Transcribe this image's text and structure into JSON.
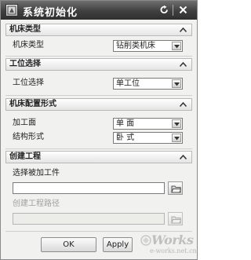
{
  "window": {
    "title": "系统初始化",
    "reset_icon": "reset-icon",
    "close_icon": "close-icon"
  },
  "sections": {
    "machine_type": {
      "title": "机床类型",
      "field_label": "机床类型",
      "field_value": "钻削类机床"
    },
    "station": {
      "title": "工位选择",
      "field_label": "工位选择",
      "field_value": "单工位"
    },
    "config": {
      "title": "机床配置形式",
      "machining_face_label": "加工面",
      "machining_face_value": "单 面",
      "structure_label": "结构形式",
      "structure_value": "卧 式"
    },
    "project": {
      "title": "创建工程",
      "select_part_label": "选择被加工件",
      "select_part_value": "",
      "project_path_label": "创建工程路径",
      "project_path_value": ""
    }
  },
  "buttons": {
    "ok": "OK",
    "apply": "Apply"
  },
  "watermark": {
    "logo": "Works",
    "sub": "e-works.net.cn"
  },
  "colors": {
    "titlebar": "#3f3f3f",
    "panel": "#f1f1ef",
    "section_header": "#e4e4e4"
  }
}
